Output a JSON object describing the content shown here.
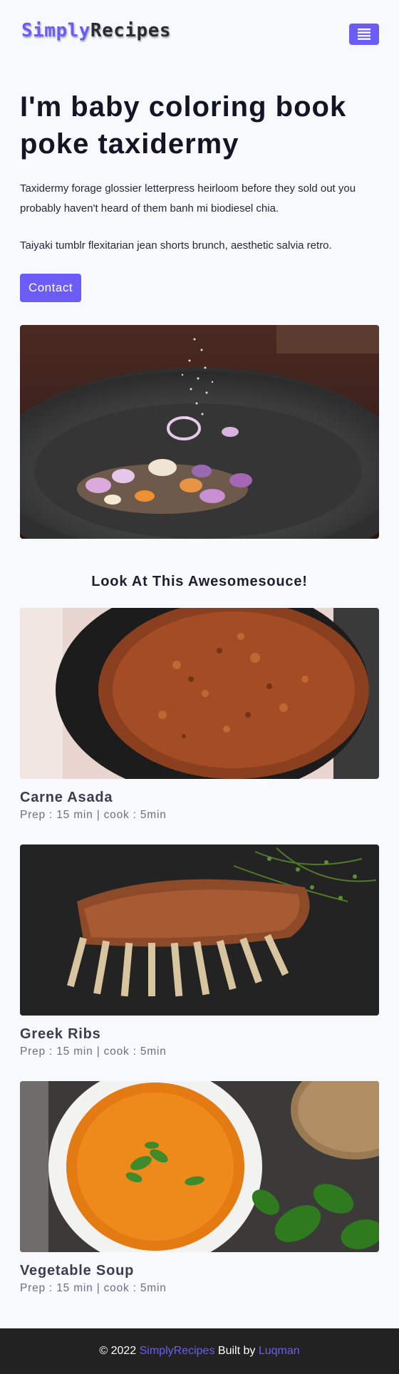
{
  "brand": {
    "part1": "Simply",
    "part2": "Recipes"
  },
  "nav": {
    "menu_icon": "hamburger-menu-icon"
  },
  "hero": {
    "title": "I'm baby coloring book poke taxidermy",
    "paragraph1": "Taxidermy forage glossier letterpress heirloom before they sold out you probably haven't heard of them banh mi biodiesel chia.",
    "paragraph2": "Taiyaki tumblr flexitarian jean shorts brunch, aesthetic salvia retro.",
    "button_label": "Contact"
  },
  "featured": {
    "title": "Look At This Awesomesouce!",
    "recipes": [
      {
        "name": "Carne Asada",
        "meta": "Prep : 15 min | cook : 5min"
      },
      {
        "name": "Greek Ribs",
        "meta": "Prep : 15 min | cook : 5min"
      },
      {
        "name": "Vegetable Soup",
        "meta": "Prep : 15 min | cook : 5min"
      }
    ]
  },
  "footer": {
    "copyright": "© 2022",
    "brand_link": "SimplyRecipes",
    "built_by": "Built by",
    "author_link": "Luqman"
  },
  "colors": {
    "accent": "#6b5cf6",
    "footer_bg": "#222222",
    "page_bg": "#f7f9fc"
  }
}
